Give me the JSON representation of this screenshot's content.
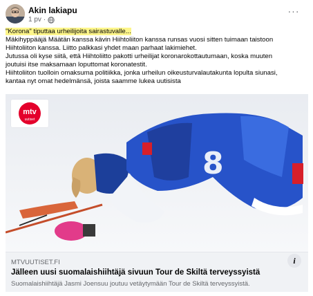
{
  "post": {
    "author": "Akin lakiapu",
    "time": "1 pv",
    "separator": "·",
    "visibility_icon": "globe-icon",
    "more_icon": "more-options-icon",
    "more_label": "···",
    "text": {
      "highlight": "\"Korona\" tiputtaa urheilijoita sairastuvalle...",
      "lines": [
        "Mäkihyppääjä Määtän kanssa kävin Hiihtoliiton kanssa runsas vuosi sitten tuimaan taistoon",
        "Hiihtoliiton kanssa. Liitto palkkasi yhdet maan parhaat lakimiehet.",
        "Jutussa oli kyse siitä, että Hiihtoliitto pakotti urheilijat koronarokottautumaan, koska muuten",
        "joutuisi itse maksamaan loputtomat koronatestit.",
        "Hiihtoliiton tuolloin omaksuma politiikka, jonka urheilun oikeusturvalautakunta lopulta siunasi,",
        "kantaa nyt omat hedelmänsä, joista saamme lukea uutisista"
      ]
    }
  },
  "link": {
    "image_logo": "mtv uutiset",
    "domain": "MTVUUTISET.FI",
    "title": "Jälleen uusi suomalaishiihtäjä sivuun Tour de Skiltä terveyssyistä",
    "description": "Suomalaishiihtäjä Jasmi Joensuu joutuu vetäytymään Tour de Skiltä terveyssyistä.",
    "info_icon": "info-icon",
    "info_label": "i"
  },
  "colors": {
    "highlight": "#fdf58a",
    "footer_bg": "#f0f2f5",
    "secondary_text": "#65676b",
    "mtv_red": "#e4002b"
  }
}
